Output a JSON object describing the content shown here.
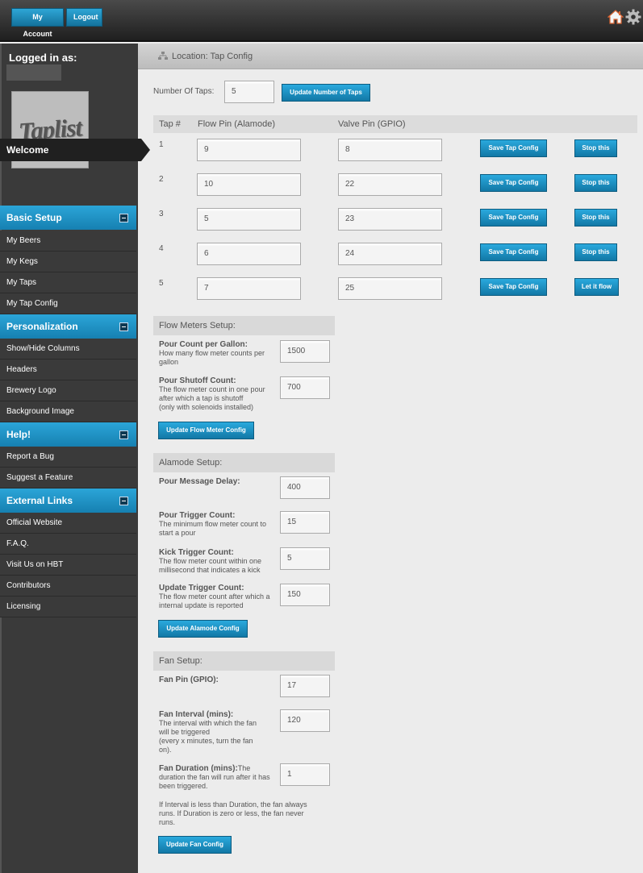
{
  "header": {
    "my_account": "My Account",
    "logout": "Logout",
    "home_icon": "home-icon",
    "settings_icon": "gear-icon"
  },
  "sidebar": {
    "logged_in_as": "Logged in as:",
    "logo_text": "Taplist",
    "welcome": "Welcome",
    "sections": [
      {
        "title": "Basic Setup",
        "items": [
          "My Beers",
          "My Kegs",
          "My Taps",
          "My Tap Config"
        ]
      },
      {
        "title": "Personalization",
        "items": [
          "Show/Hide Columns",
          "Headers",
          "Brewery Logo",
          "Background Image"
        ]
      },
      {
        "title": "Help!",
        "items": [
          "Report a Bug",
          "Suggest a Feature"
        ]
      },
      {
        "title": "External Links",
        "items": [
          "Official Website",
          "F.A.Q.",
          "Visit Us on HBT",
          "Contributors",
          "Licensing"
        ]
      }
    ]
  },
  "breadcrumb": "Location: Tap Config",
  "taps": {
    "count_label": "Number Of Taps:",
    "count_value": "5",
    "update_button": "Update Number of Taps",
    "headers": {
      "tap": "Tap #",
      "flow": "Flow Pin (Alamode)",
      "valve": "Valve Pin (GPIO)"
    },
    "rows": [
      {
        "tap": "1",
        "flow": "9",
        "valve": "8",
        "save": "Save Tap Config",
        "action": "Stop this"
      },
      {
        "tap": "2",
        "flow": "10",
        "valve": "22",
        "save": "Save Tap Config",
        "action": "Stop this"
      },
      {
        "tap": "3",
        "flow": "5",
        "valve": "23",
        "save": "Save Tap Config",
        "action": "Stop this"
      },
      {
        "tap": "4",
        "flow": "6",
        "valve": "24",
        "save": "Save Tap Config",
        "action": "Stop this"
      },
      {
        "tap": "5",
        "flow": "7",
        "valve": "25",
        "save": "Save Tap Config",
        "action": "Let it flow"
      }
    ]
  },
  "flow_meters": {
    "title": "Flow Meters Setup:",
    "pour_count_label": "Pour Count per Gallon:",
    "pour_count_desc": "How many flow meter counts per gallon",
    "pour_count_value": "1500",
    "shutoff_label": "Pour Shutoff Count:",
    "shutoff_desc": "The flow meter count in one pour after which a tap is shutoff",
    "shutoff_desc2": "(only with solenoids installed)",
    "shutoff_value": "700",
    "update_button": "Update Flow Meter Config"
  },
  "alamode": {
    "title": "Alamode Setup:",
    "delay_label": "Pour Message Delay:",
    "delay_value": "400",
    "trigger_label": "Pour Trigger Count:",
    "trigger_desc": "The minimum flow meter count to start a pour",
    "trigger_value": "15",
    "kick_label": "Kick Trigger Count:",
    "kick_desc": "The flow meter count within one millisecond that indicates a kick",
    "kick_value": "5",
    "update_label": "Update Trigger Count:",
    "update_desc": "The flow meter count after which a internal update is reported",
    "update_value": "150",
    "update_button": "Update Alamode Config"
  },
  "fan": {
    "title": "Fan Setup:",
    "pin_label": "Fan Pin (GPIO):",
    "pin_value": "17",
    "interval_label": "Fan Interval (mins):",
    "interval_desc": "The interval with which the fan will be triggered",
    "interval_desc2": "(every x minutes, turn the fan on).",
    "interval_value": "120",
    "duration_label": "Fan Duration (mins):",
    "duration_desc": "The duration the fan will run after it has been triggered.",
    "duration_value": "1",
    "note": "If Interval is less than Duration, the fan always runs. If Duration is zero or less, the fan never runs.",
    "update_button": "Update Fan Config"
  }
}
